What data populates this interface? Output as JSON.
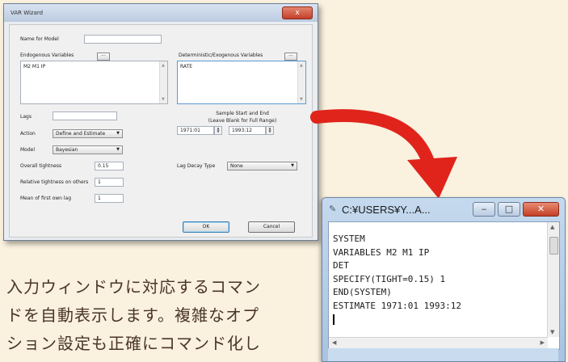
{
  "wizard": {
    "title": "VAR Wizard",
    "close_glyph": "x",
    "name_for_model_label": "Name for Model",
    "name_for_model_value": "",
    "endogenous_label": "Endogenous Variables",
    "endogenous_button": "...",
    "endogenous_value": "M2 M1 IP",
    "deterministic_label": "Deterministic/Exogenous Variables",
    "deterministic_button": "...",
    "deterministic_value": "RATE",
    "lags_label": "Lags",
    "lags_value": "",
    "sample_heading_1": "Sample Start and End",
    "sample_heading_2": "(Leave Blank for Full Range)",
    "sample_start": "1971:01",
    "sample_end": "1993:12",
    "action_label": "Action",
    "action_value": "Define and Estimate",
    "model_label": "Model",
    "model_value": "Bayesian",
    "overall_tightness_label": "Overall tightness",
    "overall_tightness_value": "0.15",
    "lag_decay_label": "Lag Decay Type",
    "lag_decay_value": "None",
    "relative_tightness_label": "Relative tightness on others",
    "relative_tightness_value": "1",
    "mean_first_lag_label": "Mean of first own lag",
    "mean_first_lag_value": "1",
    "ok_label": "OK",
    "cancel_label": "Cancel"
  },
  "caption": {
    "line1": "入力ウィンドウに対応するコマン",
    "line2": "ドを自動表示します。複雑なオプ",
    "line3": "ション設定も正確にコマンド化し"
  },
  "command_window": {
    "title": "C:¥USERS¥Y...A...",
    "lines": [
      "SYSTEM",
      "VARIABLES M2 M1 IP",
      "DET",
      "SPECIFY(TIGHT=0.15) 1",
      "END(SYSTEM)",
      "ESTIMATE 1971:01 1993:12"
    ]
  },
  "colors": {
    "background": "#faf1df",
    "arrow": "#e0241b",
    "caption_text": "#4a3528",
    "close_button": "#c9442c"
  }
}
